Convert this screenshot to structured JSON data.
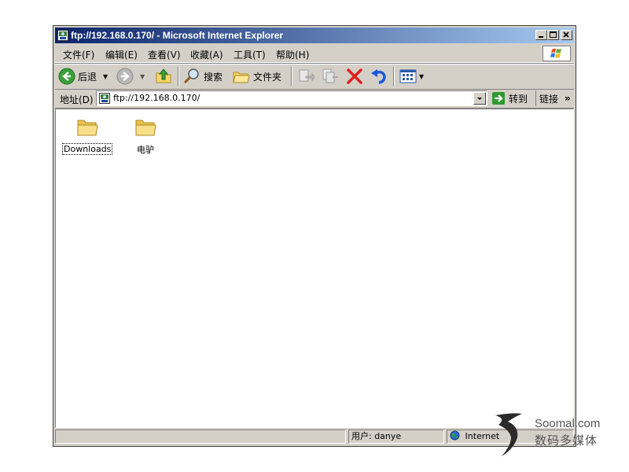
{
  "window": {
    "title": "ftp://192.168.0.170/ - Microsoft Internet Explorer"
  },
  "menu": {
    "items": [
      "文件(F)",
      "编辑(E)",
      "查看(V)",
      "收藏(A)",
      "工具(T)",
      "帮助(H)"
    ]
  },
  "toolbar": {
    "back_label": "后退",
    "search_label": "搜索",
    "folders_label": "文件夹"
  },
  "address": {
    "label": "地址(D)",
    "value": "ftp://192.168.0.170/",
    "go_label": "转到",
    "links_label": "链接",
    "chevron": "»"
  },
  "content": {
    "folders": [
      {
        "name": "Downloads",
        "icon": "folder-icon"
      },
      {
        "name": "电驴",
        "icon": "folder-icon"
      }
    ]
  },
  "status": {
    "user": "用户: danye",
    "zone": "Internet"
  },
  "watermark": {
    "brand": "Soomal.com",
    "tagline": "数码多媒体"
  },
  "colors": {
    "titlebar_start": "#0a246a",
    "titlebar_end": "#a6caf0",
    "chrome": "#d4d0c8",
    "stop_red": "#e02020",
    "go_green": "#2e9a2e",
    "folder_yellow": "#f6d66a"
  }
}
